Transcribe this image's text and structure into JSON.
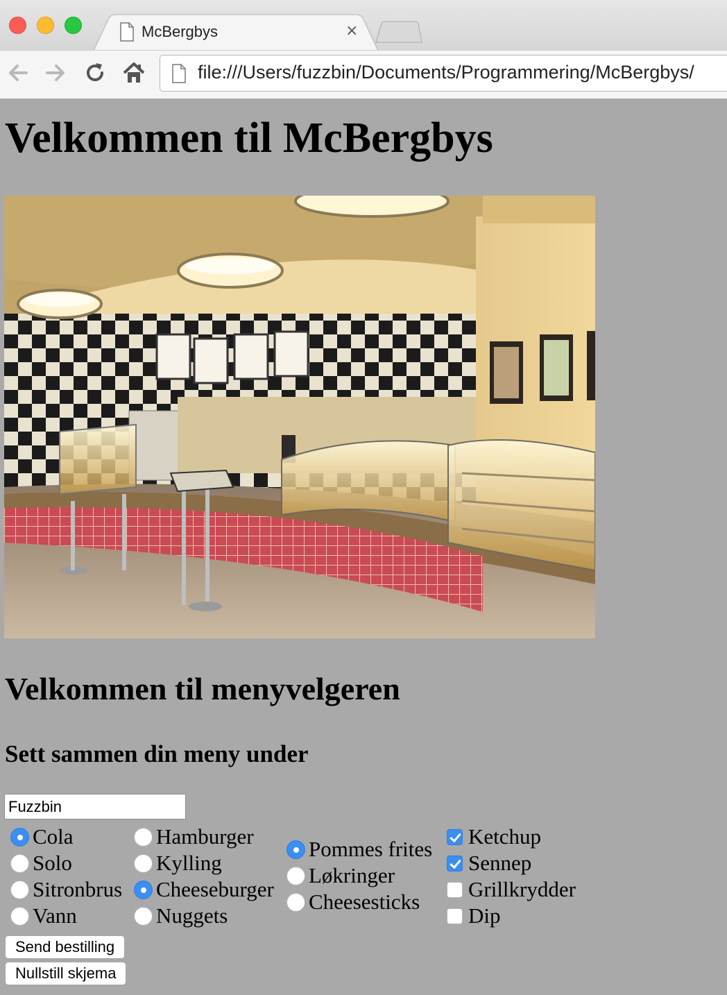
{
  "browser": {
    "tab_title": "McBergbys",
    "tab_close": "×",
    "url": "file:///Users/fuzzbin/Documents/Programmering/McBergbys/"
  },
  "page": {
    "title": "Velkommen til McBergbys",
    "subtitle": "Velkommen til menyvelgeren",
    "instruction": "Sett sammen din meny under",
    "name_value": "Fuzzbin",
    "drinks": [
      {
        "label": "Cola",
        "checked": true
      },
      {
        "label": "Solo",
        "checked": false
      },
      {
        "label": "Sitronbrus",
        "checked": false
      },
      {
        "label": "Vann",
        "checked": false
      }
    ],
    "mains": [
      {
        "label": "Hamburger",
        "checked": false
      },
      {
        "label": "Kylling",
        "checked": false
      },
      {
        "label": "Cheeseburger",
        "checked": true
      },
      {
        "label": "Nuggets",
        "checked": false
      }
    ],
    "sides": [
      {
        "label": "Pommes frites",
        "checked": true
      },
      {
        "label": "Løkringer",
        "checked": false
      },
      {
        "label": "Cheesesticks",
        "checked": false
      }
    ],
    "extras": [
      {
        "label": "Ketchup",
        "checked": true
      },
      {
        "label": "Sennep",
        "checked": true
      },
      {
        "label": "Grillkrydder",
        "checked": false
      },
      {
        "label": "Dip",
        "checked": false
      }
    ],
    "submit_label": "Send bestilling",
    "reset_label": "Nullstill skjema"
  },
  "colors": {
    "page_background": "#a9a9a9",
    "accent": "#3b8ef2"
  }
}
